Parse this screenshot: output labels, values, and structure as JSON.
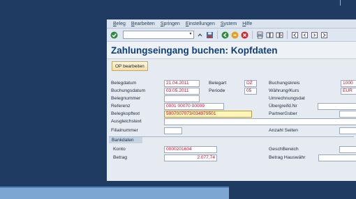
{
  "menu": [
    "Beleg",
    "Bearbeiten",
    "Springen",
    "Einstellungen",
    "System",
    "Hilfe"
  ],
  "toolbar": {
    "icons": [
      "ok-check-icon",
      "save-icon",
      "back-icon",
      "exit-icon",
      "cancel-icon",
      "print-icon",
      "find-icon",
      "find-next-icon",
      "first-page-icon",
      "prev-page-icon",
      "next-page-icon",
      "last-page-icon"
    ]
  },
  "title": "Zahlungseingang buchen: Kopfdaten",
  "op_button": "OP bearbeiten",
  "fields": {
    "belegdatum": {
      "label": "Belegdatum",
      "value": "21.04.2011"
    },
    "belegart": {
      "label": "Belegart",
      "value": "DZ"
    },
    "buchungskreis": {
      "label": "Buchungskreis",
      "value": "1000"
    },
    "buchungsdatum": {
      "label": "Buchungsdatum",
      "value": "03.05.2011"
    },
    "periode": {
      "label": "Periode",
      "value": "05"
    },
    "waehrung": {
      "label": "Währung/Kurs",
      "value": "EUR"
    },
    "belegnummer": {
      "label": "Belegnummer",
      "value": ""
    },
    "umrechnungsdat": {
      "label": "Umrechnungsdat",
      "value": ""
    },
    "referenz": {
      "label": "Referenz",
      "value": "0001 00070 00009"
    },
    "uebergreifd": {
      "label": "Übergreifd.Nr",
      "value": ""
    },
    "belegkopftext": {
      "label": "Belegkopftext",
      "value": "5907007073/034979501"
    },
    "partnergsber": {
      "label": "PartnerGsber",
      "value": ""
    },
    "ausgleichstext": {
      "label": "Ausgleichstext",
      "value": ""
    },
    "filialnummer": {
      "label": "Filialnummer",
      "value": ""
    },
    "anzahl_seiten": {
      "label": "Anzahl Seiten",
      "value": ""
    }
  },
  "bankdaten": {
    "title": "Bankdaten",
    "konto": {
      "label": "Konto",
      "value": "0000201604"
    },
    "betrag": {
      "label": "Betrag",
      "value": "2.077,74"
    },
    "geschbereich": {
      "label": "GeschBereich",
      "value": ""
    },
    "betrag_hauswaehr": {
      "label": "Betrag Hauswähr",
      "value": ""
    }
  },
  "colors": {
    "background": "#1f3b62",
    "title": "#0f3f7a",
    "value_red": "#c8102e",
    "highlight": "#fff5b4"
  }
}
